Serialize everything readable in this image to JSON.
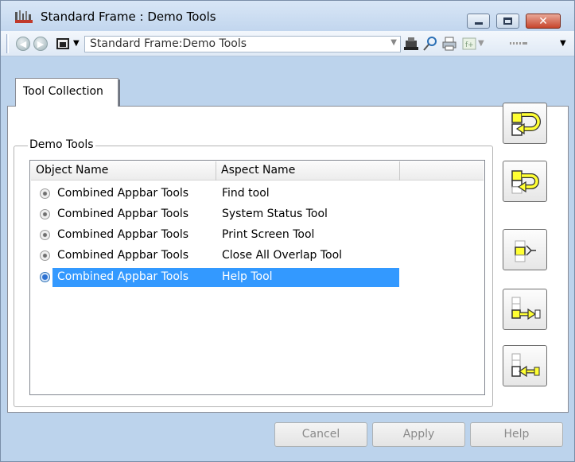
{
  "window": {
    "title": "Standard Frame : Demo Tools",
    "close_color": "#c7452c"
  },
  "toolbar": {
    "address": "Standard Frame:Demo Tools"
  },
  "tabs": [
    {
      "label": "Tool Collection",
      "selected": true
    }
  ],
  "group": {
    "label": "Demo Tools"
  },
  "list": {
    "columns": [
      "Object Name",
      "Aspect Name"
    ],
    "rows": [
      {
        "object": "Combined Appbar Tools",
        "aspect": "Find tool",
        "selected": false
      },
      {
        "object": "Combined Appbar Tools",
        "aspect": "System Status Tool",
        "selected": false
      },
      {
        "object": "Combined Appbar Tools",
        "aspect": "Print Screen Tool",
        "selected": false
      },
      {
        "object": "Combined Appbar Tools",
        "aspect": "Close All Overlap Tool",
        "selected": false
      },
      {
        "object": "Combined Appbar Tools",
        "aspect": "Help Tool",
        "selected": true
      }
    ],
    "selection_color": "#3399ff"
  },
  "buttons": {
    "cancel": "Cancel",
    "apply": "Apply",
    "help": "Help"
  }
}
